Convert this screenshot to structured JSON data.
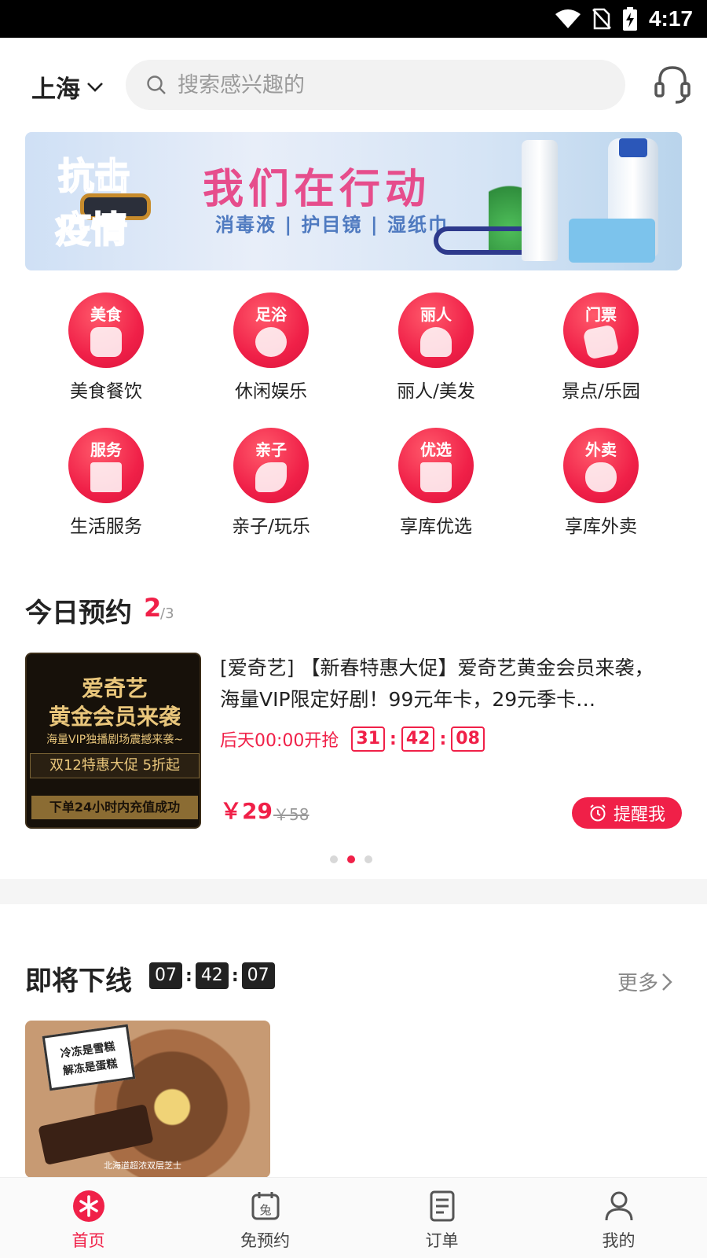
{
  "status_bar": {
    "time": "4:17"
  },
  "header": {
    "city": "上海",
    "search_placeholder": "搜索感兴趣的"
  },
  "banner": {
    "left_line1": "抗击",
    "left_line2": "疫情",
    "title": "我们在行动",
    "subtitle": "消毒液 | 护目镜 | 湿纸巾"
  },
  "categories": [
    {
      "badge": "美食",
      "label": "美食餐饮",
      "icon": "food-icon"
    },
    {
      "badge": "足浴",
      "label": "休闲娱乐",
      "icon": "footbath-icon"
    },
    {
      "badge": "丽人",
      "label": "丽人/美发",
      "icon": "beauty-icon"
    },
    {
      "badge": "门票",
      "label": "景点/乐园",
      "icon": "ticket-icon"
    },
    {
      "badge": "服务",
      "label": "生活服务",
      "icon": "shop-icon"
    },
    {
      "badge": "亲子",
      "label": "亲子/玩乐",
      "icon": "rocking-horse-icon"
    },
    {
      "badge": "优选",
      "label": "享库优选",
      "icon": "shopping-bag-icon"
    },
    {
      "badge": "外卖",
      "label": "享库外卖",
      "icon": "delivery-scooter-icon"
    }
  ],
  "today": {
    "title": "今日预约",
    "current": "2",
    "total": "/3",
    "deal": {
      "image_lines": [
        "爱奇艺",
        "黄金会员来袭",
        "海量VIP独播剧场震撼来袭~",
        "双12特惠大促  5折起",
        "下单24小时内充值成功"
      ],
      "title": "[爱奇艺] 【新春特惠大促】爱奇艺黄金会员来袭，海量VIP限定好剧！99元年卡，29元季卡…",
      "start_text": "后天00:00开抢",
      "timer": [
        "31",
        "42",
        "08"
      ],
      "price": "￥29",
      "original_price": "￥58",
      "remind_label": "提醒我"
    }
  },
  "offline": {
    "title": "即将下线",
    "timer": [
      "07",
      "42",
      "07"
    ],
    "more_label": "更多",
    "image_tag_line1": "冷冻是雪糕",
    "image_tag_line2": "解冻是蛋糕",
    "image_caption": "北海道超浓双层芝士"
  },
  "bottom_nav": [
    {
      "label": "首页",
      "icon": "home-icon",
      "active": true
    },
    {
      "label": "免预约",
      "icon": "calendar-free-icon",
      "active": false
    },
    {
      "label": "订单",
      "icon": "order-list-icon",
      "active": false
    },
    {
      "label": "我的",
      "icon": "user-icon",
      "active": false
    }
  ],
  "colors": {
    "accent": "#f02048",
    "dark_timer": "#222222"
  }
}
